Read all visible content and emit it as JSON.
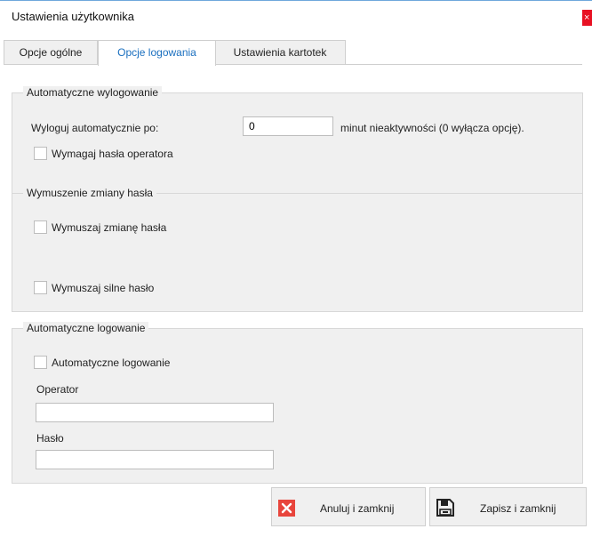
{
  "window": {
    "title": "Ustawienia użytkownika",
    "close_glyph": "×"
  },
  "tabs": [
    {
      "label": "Opcje ogólne",
      "active": false
    },
    {
      "label": "Opcje logowania",
      "active": true
    },
    {
      "label": "Ustawienia kartotek",
      "active": false
    }
  ],
  "auto_logout": {
    "legend": "Automatyczne wylogowanie",
    "label": "Wyloguj automatycznie po:",
    "minutes_value": "0",
    "suffix": "minut nieaktywności (0 wyłącza opcję).",
    "require_password_label": "Wymagaj hasła operatora",
    "require_password_checked": false
  },
  "force_change": {
    "legend": "Wymuszenie zmiany hasła",
    "force_change_label": "Wymuszaj zmianę hasła",
    "force_change_checked": false,
    "force_strong_label": "Wymuszaj silne hasło",
    "force_strong_checked": false
  },
  "auto_login": {
    "legend": "Automatyczne logowanie",
    "checkbox_label": "Automatyczne logowanie",
    "checked": false,
    "operator_label": "Operator",
    "operator_value": "",
    "password_label": "Hasło",
    "password_value": ""
  },
  "buttons": {
    "cancel_label": "Anuluj i zamknij",
    "save_label": "Zapisz i zamknij"
  },
  "colors": {
    "accent": "#1a6fbf",
    "cancel_icon": "#e8453c",
    "window_bg": "#f0f0f0"
  }
}
